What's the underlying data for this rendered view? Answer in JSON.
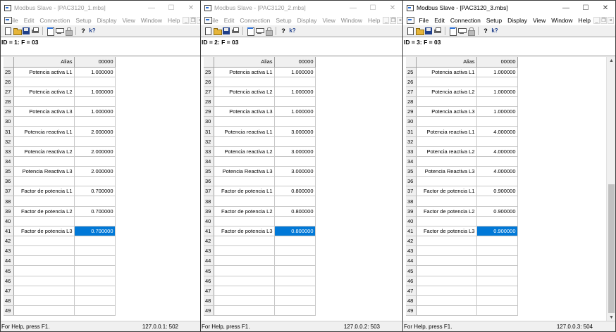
{
  "windows": [
    {
      "title": "Modbus Slave - [PAC3120_1.mbs]",
      "active": false,
      "id_line": "ID = 1: F = 03",
      "address_header": "00000",
      "alias_header": "Alias",
      "selected_row": 41,
      "rows": [
        {
          "num": "25",
          "alias": "Potencia activa L1",
          "value": "1.000000"
        },
        {
          "num": "26",
          "alias": "",
          "value": ""
        },
        {
          "num": "27",
          "alias": "Potencia activa L2",
          "value": "1.000000"
        },
        {
          "num": "28",
          "alias": "",
          "value": ""
        },
        {
          "num": "29",
          "alias": "Potencia activa L3",
          "value": "1.000000"
        },
        {
          "num": "30",
          "alias": "",
          "value": ""
        },
        {
          "num": "31",
          "alias": "Potencia reactiva L1",
          "value": "2.000000"
        },
        {
          "num": "32",
          "alias": "",
          "value": ""
        },
        {
          "num": "33",
          "alias": "Potencia reactiva L2",
          "value": "2.000000"
        },
        {
          "num": "34",
          "alias": "",
          "value": ""
        },
        {
          "num": "35",
          "alias": "Potencia Reactiva L3",
          "value": "2.000000"
        },
        {
          "num": "36",
          "alias": "",
          "value": ""
        },
        {
          "num": "37",
          "alias": "Factor de potencia L1",
          "value": "0.700000"
        },
        {
          "num": "38",
          "alias": "",
          "value": ""
        },
        {
          "num": "39",
          "alias": "Factor de potencia L2",
          "value": "0.700000"
        },
        {
          "num": "40",
          "alias": "",
          "value": ""
        },
        {
          "num": "41",
          "alias": "Factor de potencia L3",
          "value": "0.700000"
        },
        {
          "num": "42",
          "alias": "",
          "value": ""
        },
        {
          "num": "43",
          "alias": "",
          "value": ""
        },
        {
          "num": "44",
          "alias": "",
          "value": ""
        },
        {
          "num": "45",
          "alias": "",
          "value": ""
        },
        {
          "num": "46",
          "alias": "",
          "value": ""
        },
        {
          "num": "47",
          "alias": "",
          "value": ""
        },
        {
          "num": "48",
          "alias": "",
          "value": ""
        },
        {
          "num": "49",
          "alias": "",
          "value": ""
        }
      ],
      "status_left": "For Help, press F1.",
      "status_right": "127.0.0.1: 502",
      "has_scrollbar": false
    },
    {
      "title": "Modbus Slave - [PAC3120_2.mbs]",
      "active": false,
      "id_line": "ID = 2: F = 03",
      "address_header": "00000",
      "alias_header": "Alias",
      "selected_row": 41,
      "rows": [
        {
          "num": "25",
          "alias": "Potencia activa L1",
          "value": "1.000000"
        },
        {
          "num": "26",
          "alias": "",
          "value": ""
        },
        {
          "num": "27",
          "alias": "Potencia activa L2",
          "value": "1.000000"
        },
        {
          "num": "28",
          "alias": "",
          "value": ""
        },
        {
          "num": "29",
          "alias": "Potencia activa L3",
          "value": "1.000000"
        },
        {
          "num": "30",
          "alias": "",
          "value": ""
        },
        {
          "num": "31",
          "alias": "Potencia reactiva L1",
          "value": "3.000000"
        },
        {
          "num": "32",
          "alias": "",
          "value": ""
        },
        {
          "num": "33",
          "alias": "Potencia reactiva L2",
          "value": "3.000000"
        },
        {
          "num": "34",
          "alias": "",
          "value": ""
        },
        {
          "num": "35",
          "alias": "Potencia Reactiva L3",
          "value": "3.000000"
        },
        {
          "num": "36",
          "alias": "",
          "value": ""
        },
        {
          "num": "37",
          "alias": "Factor de potencia L1",
          "value": "0.800000"
        },
        {
          "num": "38",
          "alias": "",
          "value": ""
        },
        {
          "num": "39",
          "alias": "Factor de potencia L2",
          "value": "0.800000"
        },
        {
          "num": "40",
          "alias": "",
          "value": ""
        },
        {
          "num": "41",
          "alias": "Factor de potencia L3",
          "value": "0.800000"
        },
        {
          "num": "42",
          "alias": "",
          "value": ""
        },
        {
          "num": "43",
          "alias": "",
          "value": ""
        },
        {
          "num": "44",
          "alias": "",
          "value": ""
        },
        {
          "num": "45",
          "alias": "",
          "value": ""
        },
        {
          "num": "46",
          "alias": "",
          "value": ""
        },
        {
          "num": "47",
          "alias": "",
          "value": ""
        },
        {
          "num": "48",
          "alias": "",
          "value": ""
        },
        {
          "num": "49",
          "alias": "",
          "value": ""
        }
      ],
      "status_left": "For Help, press F1.",
      "status_right": "127.0.0.2: 503",
      "has_scrollbar": false
    },
    {
      "title": "Modbus Slave - [PAC3120_3.mbs]",
      "active": true,
      "id_line": "ID = 3: F = 03",
      "address_header": "00000",
      "alias_header": "Alias",
      "selected_row": 41,
      "rows": [
        {
          "num": "25",
          "alias": "Potencia activa L1",
          "value": "1.000000"
        },
        {
          "num": "26",
          "alias": "",
          "value": ""
        },
        {
          "num": "27",
          "alias": "Potencia activa L2",
          "value": "1.000000"
        },
        {
          "num": "28",
          "alias": "",
          "value": ""
        },
        {
          "num": "29",
          "alias": "Potencia activa L3",
          "value": "1.000000"
        },
        {
          "num": "30",
          "alias": "",
          "value": ""
        },
        {
          "num": "31",
          "alias": "Potencia reactiva L1",
          "value": "4.000000"
        },
        {
          "num": "32",
          "alias": "",
          "value": ""
        },
        {
          "num": "33",
          "alias": "Potencia reactiva L2",
          "value": "4.000000"
        },
        {
          "num": "34",
          "alias": "",
          "value": ""
        },
        {
          "num": "35",
          "alias": "Potencia Reactiva L3",
          "value": "4.000000"
        },
        {
          "num": "36",
          "alias": "",
          "value": ""
        },
        {
          "num": "37",
          "alias": "Factor de potencia L1",
          "value": "0.900000"
        },
        {
          "num": "38",
          "alias": "",
          "value": ""
        },
        {
          "num": "39",
          "alias": "Factor de potencia L2",
          "value": "0.900000"
        },
        {
          "num": "40",
          "alias": "",
          "value": ""
        },
        {
          "num": "41",
          "alias": "Factor de potencia L3",
          "value": "0.900000"
        },
        {
          "num": "42",
          "alias": "",
          "value": ""
        },
        {
          "num": "43",
          "alias": "",
          "value": ""
        },
        {
          "num": "44",
          "alias": "",
          "value": ""
        },
        {
          "num": "45",
          "alias": "",
          "value": ""
        },
        {
          "num": "46",
          "alias": "",
          "value": ""
        },
        {
          "num": "47",
          "alias": "",
          "value": ""
        },
        {
          "num": "48",
          "alias": "",
          "value": ""
        },
        {
          "num": "49",
          "alias": "",
          "value": ""
        }
      ],
      "status_left": "For Help, press F1.",
      "status_right": "127.0.0.3: 504",
      "has_scrollbar": true
    }
  ],
  "menu": [
    "File",
    "Edit",
    "Connection",
    "Setup",
    "Display",
    "View",
    "Window",
    "Help"
  ],
  "window_controls": {
    "minimize": "—",
    "maximize": "☐",
    "close": "✕"
  },
  "mdi_controls": {
    "minimize": "_",
    "restore": "❐",
    "close": "×"
  },
  "toolbar_icons": [
    "new-icon",
    "open-icon",
    "save-icon",
    "print-icon",
    "window-icon",
    "monitor-icon",
    "lock-icon",
    "help-icon",
    "whats-this-icon"
  ],
  "toolbar_glyphs": {
    "help": "?",
    "whats_this": "k?"
  },
  "scroll_arrows": {
    "up": "▲",
    "down": "▼"
  },
  "colors": {
    "selection": "#0078d7",
    "title_inactive": "#9a9a9a",
    "grid_header": "#f0f0f0"
  }
}
